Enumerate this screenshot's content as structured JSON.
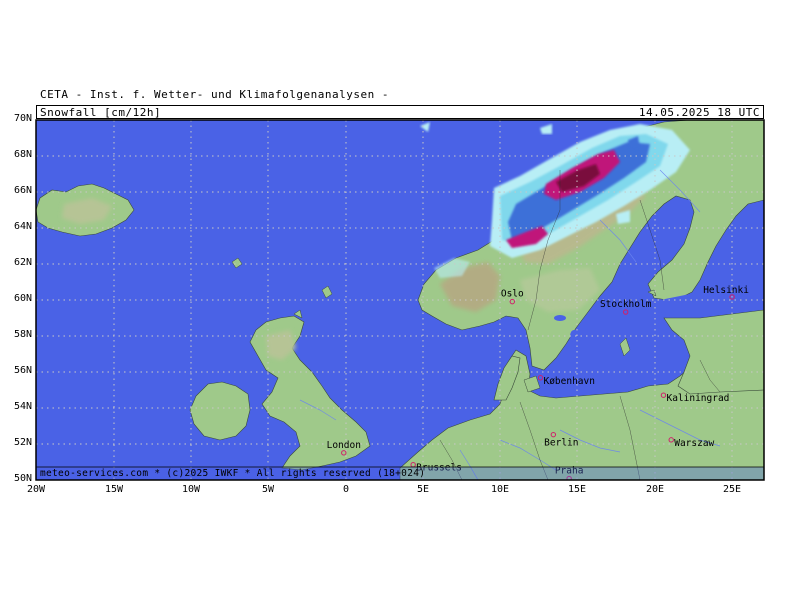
{
  "header": {
    "organization": "CETA - Inst. f. Wetter- und Klimafolgenanalysen -",
    "parameter": "Snowfall [cm/12h]",
    "datetime": "14.05.2025  18 UTC"
  },
  "footer": "meteo-services.com * (c)2025 IWKF * All rights reserved (18+024)",
  "axes": {
    "lat_labels": [
      "70N",
      "68N",
      "66N",
      "64N",
      "62N",
      "60N",
      "58N",
      "56N",
      "54N",
      "52N",
      "50N"
    ],
    "lon_labels": [
      "20W",
      "15W",
      "10W",
      "5W",
      "0",
      "5E",
      "10E",
      "15E",
      "20E",
      "25E"
    ]
  },
  "cities": [
    {
      "name": "Oslo",
      "lon": 10.75,
      "lat": 59.91,
      "label_pos": "above"
    },
    {
      "name": "Stockholm",
      "lon": 18.07,
      "lat": 59.33,
      "label_pos": "above"
    },
    {
      "name": "Helsinki",
      "lon": 24.94,
      "lat": 60.17,
      "label_pos": "above-left"
    },
    {
      "name": "København",
      "lon": 12.57,
      "lat": 55.68,
      "label_pos": "right"
    },
    {
      "name": "Kaliningrad",
      "lon": 20.51,
      "lat": 54.71,
      "label_pos": "right"
    },
    {
      "name": "London",
      "lon": -0.13,
      "lat": 51.51,
      "label_pos": "above"
    },
    {
      "name": "Berlin",
      "lon": 13.4,
      "lat": 52.52,
      "label_pos": "below"
    },
    {
      "name": "Warszaw",
      "lon": 21.01,
      "lat": 52.23,
      "label_pos": "right"
    },
    {
      "name": "Brussels",
      "lon": 4.35,
      "lat": 50.85,
      "label_pos": "right"
    },
    {
      "name": "Praha",
      "lon": 14.42,
      "lat": 50.08,
      "label_pos": "above"
    }
  ],
  "colors": {
    "sea": "#4a62e6",
    "land_low": "#9fc98a",
    "land_mid": "#b5c99a",
    "land_high": "#c2b38f",
    "snow_light": "#b8eef5",
    "snow_cyan": "#80d8ec",
    "snow_blue": "#3c6fd8",
    "snow_heavy": "#c0127a",
    "snow_extreme": "#7a0a3c",
    "city_marker": "#d0206a",
    "grid": "#c8c8c8"
  }
}
